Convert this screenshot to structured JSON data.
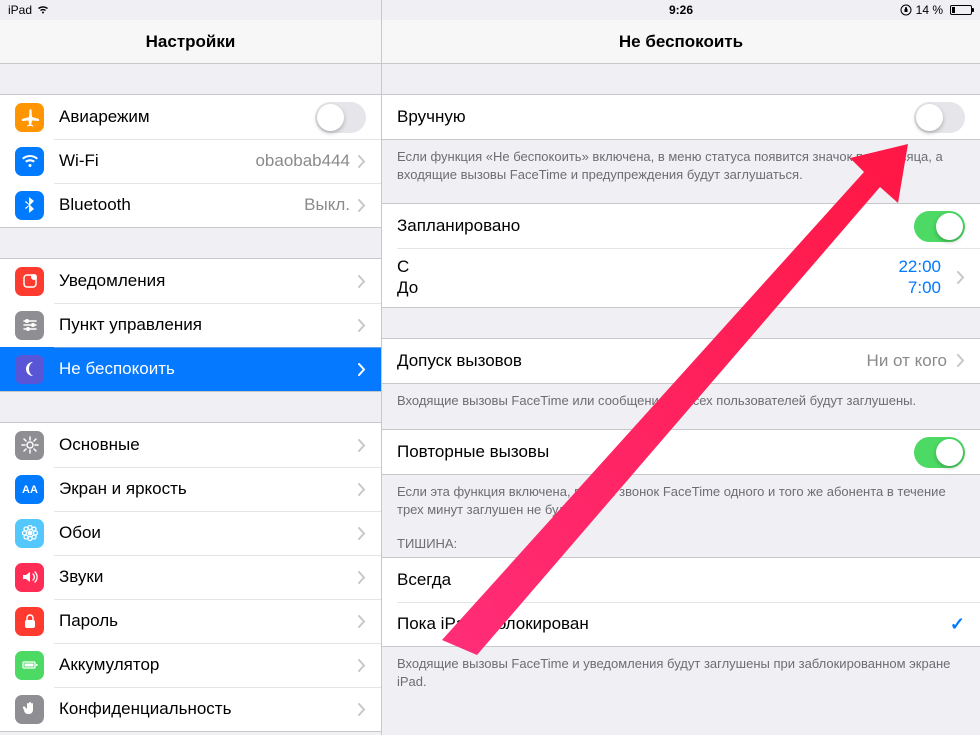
{
  "statusbar": {
    "device": "iPad",
    "time": "9:26",
    "battery_text": "14 %"
  },
  "left": {
    "title": "Настройки",
    "group1": [
      {
        "key": "airplane",
        "label": "Авиарежим",
        "value": "",
        "type": "toggle",
        "on": false,
        "icon": "airplane",
        "bg": "#ff9500"
      },
      {
        "key": "wifi",
        "label": "Wi-Fi",
        "value": "obaobab444",
        "type": "link",
        "icon": "wifi",
        "bg": "#007aff"
      },
      {
        "key": "bluetooth",
        "label": "Bluetooth",
        "value": "Выкл.",
        "type": "link",
        "icon": "bluetooth",
        "bg": "#007aff"
      }
    ],
    "group2": [
      {
        "key": "notifications",
        "label": "Уведомления",
        "icon": "notifications",
        "bg": "#ff3b30"
      },
      {
        "key": "controlcenter",
        "label": "Пункт управления",
        "icon": "controls",
        "bg": "#8e8e93"
      },
      {
        "key": "dnd",
        "label": "Не беспокоить",
        "icon": "moon",
        "bg": "#5856d6",
        "selected": true
      }
    ],
    "group3": [
      {
        "key": "general",
        "label": "Основные",
        "icon": "gear",
        "bg": "#8e8e93"
      },
      {
        "key": "display",
        "label": "Экран и яркость",
        "icon": "aa",
        "bg": "#007aff"
      },
      {
        "key": "wallpaper",
        "label": "Обои",
        "icon": "flower",
        "bg": "#54c7fc"
      },
      {
        "key": "sounds",
        "label": "Звуки",
        "icon": "speaker",
        "bg": "#ff2d55"
      },
      {
        "key": "passcode",
        "label": "Пароль",
        "icon": "lock",
        "bg": "#ff3b30"
      },
      {
        "key": "battery",
        "label": "Аккумулятор",
        "icon": "battery",
        "bg": "#4cd964"
      },
      {
        "key": "privacy",
        "label": "Конфиденциальность",
        "icon": "hand",
        "bg": "#8e8e93"
      }
    ]
  },
  "right": {
    "title": "Не беспокоить",
    "manual": {
      "label": "Вручную",
      "on": false
    },
    "manual_footer": "Если функция «Не беспокоить» включена, в меню статуса появится значок полумесяца, а входящие вызовы FaceTime и предупреждения будут заглушаться.",
    "scheduled": {
      "label": "Запланировано",
      "on": true
    },
    "schedule": {
      "from_label": "С",
      "to_label": "До",
      "from_value": "22:00",
      "to_value": "7:00"
    },
    "allow": {
      "label": "Допуск вызовов",
      "value": "Ни от кого"
    },
    "allow_footer": "Входящие вызовы FaceTime или сообщения от всех пользователей будут заглушены.",
    "repeated": {
      "label": "Повторные вызовы",
      "on": true
    },
    "repeated_footer": "Если эта функция включена, второй звонок FaceTime одного и того же абонента в течение трех минут заглушен не будет.",
    "silence_header": "ТИШИНА:",
    "silence_options": [
      {
        "label": "Всегда",
        "checked": false
      },
      {
        "label": "Пока iPad заблокирован",
        "checked": true
      }
    ],
    "silence_footer": "Входящие вызовы FaceTime и уведомления будут заглушены при заблокированном экране iPad."
  }
}
